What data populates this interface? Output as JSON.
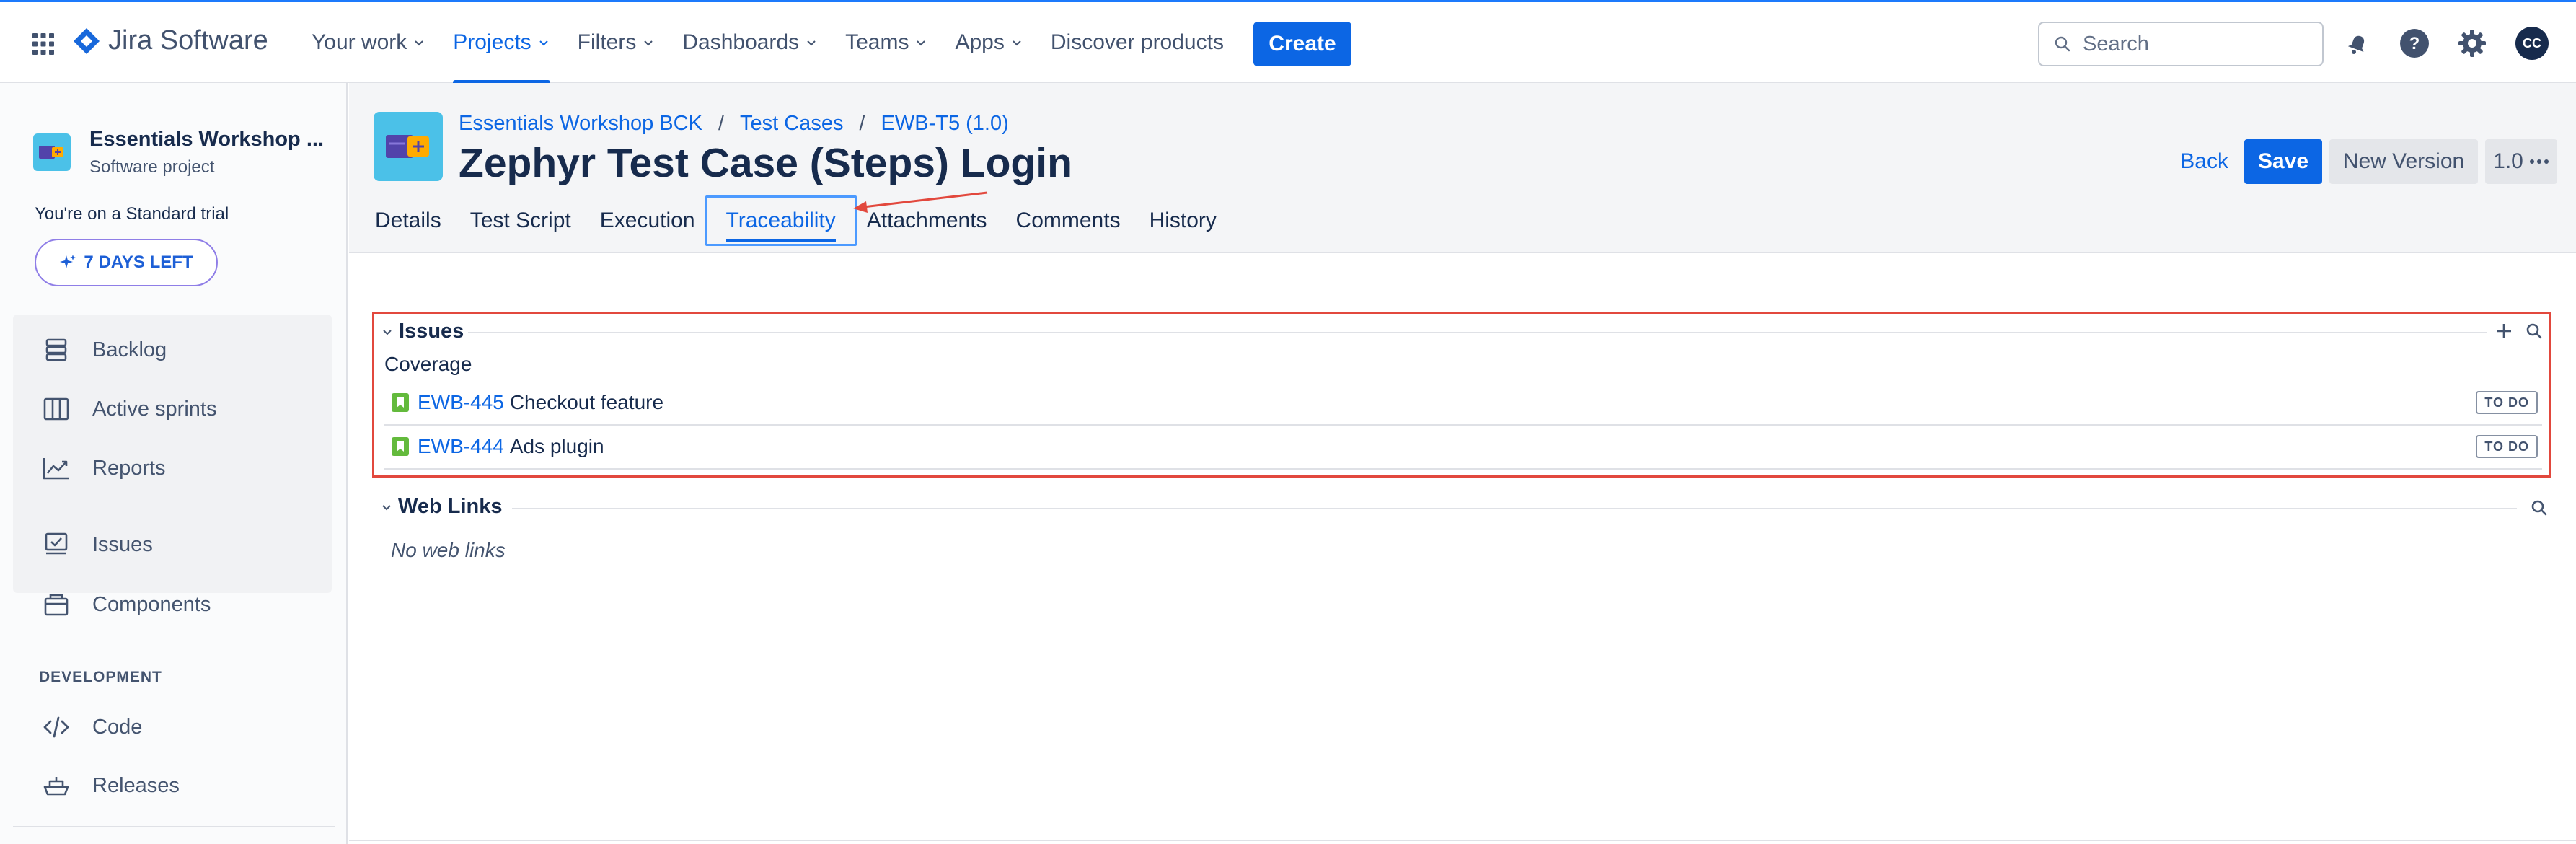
{
  "topbar": {
    "app_name": "Jira Software",
    "nav": [
      {
        "label": "Your work",
        "active": false,
        "dropdown": true
      },
      {
        "label": "Projects",
        "active": true,
        "dropdown": true
      },
      {
        "label": "Filters",
        "active": false,
        "dropdown": true
      },
      {
        "label": "Dashboards",
        "active": false,
        "dropdown": true
      },
      {
        "label": "Teams",
        "active": false,
        "dropdown": true
      },
      {
        "label": "Apps",
        "active": false,
        "dropdown": true
      },
      {
        "label": "Discover products",
        "active": false,
        "dropdown": false
      }
    ],
    "create_label": "Create",
    "search_placeholder": "Search",
    "icons": [
      "notifications-icon",
      "help-icon",
      "settings-icon"
    ],
    "avatar_initials": "CC"
  },
  "sidebar": {
    "project_name": "Essentials Workshop ...",
    "project_type": "Software project",
    "trial_text": "You're on a Standard trial",
    "trial_button": "7 DAYS LEFT",
    "planning_items": [
      {
        "label": "Backlog",
        "icon": "backlog-icon"
      },
      {
        "label": "Active sprints",
        "icon": "board-icon"
      },
      {
        "label": "Reports",
        "icon": "reports-icon"
      }
    ],
    "items": [
      {
        "label": "Issues",
        "icon": "issues-icon"
      },
      {
        "label": "Components",
        "icon": "components-icon"
      }
    ],
    "development_heading": "DEVELOPMENT",
    "dev_items": [
      {
        "label": "Code",
        "icon": "code-icon"
      },
      {
        "label": "Releases",
        "icon": "releases-icon"
      }
    ]
  },
  "header": {
    "breadcrumbs": [
      "Essentials Workshop BCK",
      "Test Cases",
      "EWB-T5 (1.0)"
    ],
    "title": "Zephyr Test Case (Steps) Login",
    "back_label": "Back",
    "save_label": "Save",
    "new_version_label": "New Version",
    "version_label": "1.0",
    "tabs": [
      {
        "label": "Details",
        "active": false
      },
      {
        "label": "Test Script",
        "active": false
      },
      {
        "label": "Execution",
        "active": false
      },
      {
        "label": "Traceability",
        "active": true
      },
      {
        "label": "Attachments",
        "active": false
      },
      {
        "label": "Comments",
        "active": false
      },
      {
        "label": "History",
        "active": false
      }
    ]
  },
  "traceability": {
    "issues_heading": "Issues",
    "coverage_label": "Coverage",
    "issues": [
      {
        "key": "EWB-445",
        "summary": "Checkout feature",
        "status": "TO DO"
      },
      {
        "key": "EWB-444",
        "summary": "Ads plugin",
        "status": "TO DO"
      }
    ],
    "web_links_heading": "Web Links",
    "no_web_links": "No web links"
  },
  "colors": {
    "primary": "#0c66e4",
    "highlight_box": "#e2483d",
    "active_tab_outline": "#4c9aff",
    "story_icon": "#63ba3c"
  }
}
